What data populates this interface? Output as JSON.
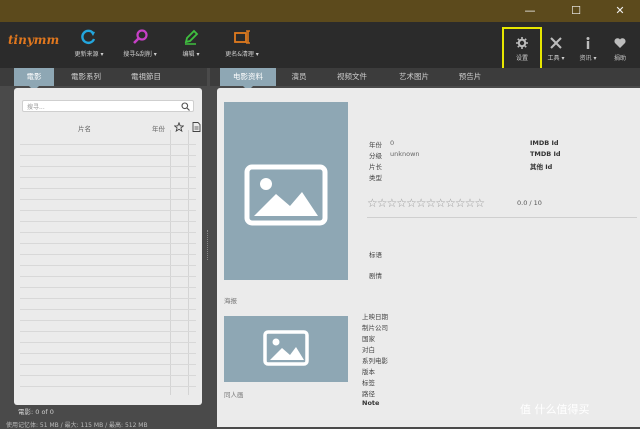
{
  "window": {
    "minimize": "—",
    "maximize": "☐",
    "close": "✕"
  },
  "app": {
    "logo": "tinymm"
  },
  "toolbar": [
    {
      "label": "更新来源 ▾",
      "icon": "refresh-icon",
      "color": "#23a6de"
    },
    {
      "label": "搜寻&刮削 ▾",
      "icon": "search-icon",
      "color": "#c640c6"
    },
    {
      "label": "编辑 ▾",
      "icon": "edit-icon",
      "color": "#3fbf3f"
    },
    {
      "label": "更名&清理 ▾",
      "icon": "rename-icon",
      "color": "#e07a1e"
    }
  ],
  "right_toolbar": [
    {
      "label": "设置",
      "icon": "gear-icon"
    },
    {
      "label": "工具 ▾",
      "icon": "tools-icon"
    },
    {
      "label": "资讯 ▾",
      "icon": "info-icon"
    },
    {
      "label": "捐助",
      "icon": "heart-icon"
    }
  ],
  "left_tabs": [
    "電影",
    "電影系列",
    "電視節目"
  ],
  "right_tabs": [
    "电影资料",
    "演员",
    "视频文件",
    "艺术图片",
    "预告片"
  ],
  "left_panel": {
    "search_placeholder": "搜寻...",
    "columns": {
      "title": "片名",
      "year": "年份"
    }
  },
  "status_bar": "電影:  0  of  0",
  "status_bar_bottom": "使用记忆体: 51 MB / 最大: 115 MB / 最高: 512 MB",
  "details": {
    "year_label": "年份",
    "year_value": "0",
    "rating_label": "分级",
    "rating_value": "unknown",
    "runtime_label": "片长",
    "genre_label": "类型",
    "imdb_label": "IMDB Id",
    "tmdb_label": "TMDB Id",
    "other_id_label": "其他 Id",
    "score": "0.0 / 10",
    "tagline_label": "标语",
    "plot_label": "剧情",
    "poster_caption": "海报",
    "fanart_caption": "同人画",
    "release_date_label": "上映日期",
    "production_label": "制片公司",
    "country_label": "国家",
    "spoken_label": "对白",
    "collection_label": "系列电影",
    "edition_label": "版本",
    "tags_label": "标签",
    "path_label": "路径",
    "note_label": "Note"
  },
  "watermark": "值 什么值得买"
}
